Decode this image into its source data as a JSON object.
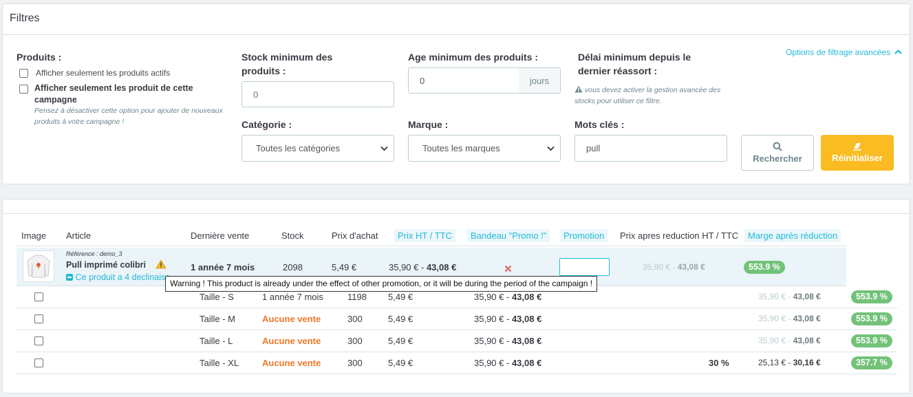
{
  "filters": {
    "title": "Filtres",
    "advanced_link": "Options de filtrage avancées",
    "products_label": "Produits :",
    "active_only_label": "Afficher seulement les produits actifs",
    "campaign_only_label": "Afficher seulement les produit de cette campagne",
    "campaign_hint": "Pensez à désactiver cette option pour ajouter de nouveaux produits à votre campagne !",
    "stock_min_label": "Stock minimum des produits :",
    "stock_min_placeholder": "0",
    "age_min_label": "Age minimum des produits :",
    "age_min_value": "0",
    "age_unit": "jours",
    "restock_label": "Délai minimum depuis le dernier réassort :",
    "restock_hint": "vous devez activer la gestion avancée des stocks pour utiliser ce filtre.",
    "category_label": "Catégorie :",
    "category_value": "Toutes les catégories",
    "brand_label": "Marque :",
    "brand_value": "Toutes les marques",
    "keywords_label": "Mots clés :",
    "keywords_value": "pull",
    "search_button": "Rechercher",
    "reset_button": "Réinitialiser"
  },
  "table": {
    "columns": [
      "Image",
      "Article",
      "Dernière vente",
      "Stock",
      "Prix d'achat",
      "Prix HT / TTC",
      "Bandeau \"Promo !\"",
      "Promotion",
      "Prix apres reduction HT / TTC",
      "Marge après réduction"
    ],
    "product": {
      "reference": "Référence : demo_3",
      "name": "Pull imprimé colibri",
      "variants_link": "Ce produit a 4 declinaisons",
      "last_sale": "1 année 7 mois",
      "stock": "2098",
      "purchase_price": "5,49 €",
      "price_ht": "35,90 €",
      "price_ttc": "43,08 €",
      "reduced_ht": "35,90 €",
      "reduced_ttc": "43,08 €",
      "margin": "553.9 %"
    },
    "tooltip": "Warning ! This product is already under the effect of other promotion, or it will be during the period of the campaign !",
    "variants": [
      {
        "name": "Taille - S",
        "last_sale": "1 année 7 mois",
        "stock": "1198",
        "purchase": "5,49 €",
        "price_ht": "35,90 €",
        "price_ttc": "43,08 €",
        "promo": "",
        "reduced_ht": "35,90 €",
        "reduced_ttc": "43,08 €",
        "margin": "553.9 %"
      },
      {
        "name": "Taille - M",
        "last_sale": "Aucune vente",
        "stock": "300",
        "purchase": "5,49 €",
        "price_ht": "35,90 €",
        "price_ttc": "43,08 €",
        "promo": "",
        "reduced_ht": "35,90 €",
        "reduced_ttc": "43,08 €",
        "margin": "553.9 %"
      },
      {
        "name": "Taille - L",
        "last_sale": "Aucune vente",
        "stock": "300",
        "purchase": "5,49 €",
        "price_ht": "35,90 €",
        "price_ttc": "43,08 €",
        "promo": "",
        "reduced_ht": "35,90 €",
        "reduced_ttc": "43,08 €",
        "margin": "553.9 %"
      },
      {
        "name": "Taille - XL",
        "last_sale": "Aucune vente",
        "stock": "300",
        "purchase": "5,49 €",
        "price_ht": "35,90 €",
        "price_ttc": "43,08 €",
        "promo": "30 %",
        "reduced_ht": "25,13 €",
        "reduced_ttc": "30,16 €",
        "margin": "357.7 %"
      }
    ]
  },
  "colors": {
    "accent": "#25b9d7",
    "warning": "#fbbb22",
    "success": "#72c279",
    "danger": "#f0772a"
  }
}
